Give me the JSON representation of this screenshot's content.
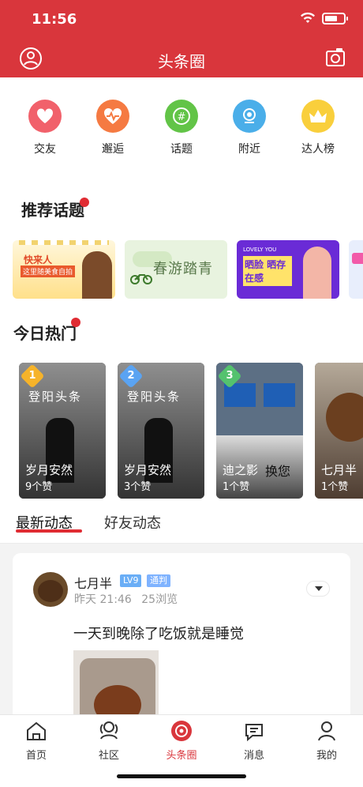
{
  "status_bar": {
    "time": "11:56"
  },
  "header": {
    "title": "头条圈"
  },
  "quick_links": [
    {
      "label": "交友",
      "icon": "heart-icon",
      "color": "#f1616b"
    },
    {
      "label": "邂逅",
      "icon": "pulse-heart-icon",
      "color": "#f57a42"
    },
    {
      "label": "话题",
      "icon": "hash-chat-icon",
      "color": "#62c447"
    },
    {
      "label": "附近",
      "icon": "location-icon",
      "color": "#4aaee9"
    },
    {
      "label": "达人榜",
      "icon": "crown-icon",
      "color": "#f9cf3c"
    }
  ],
  "topics": {
    "title": "推荐话题",
    "banners": [
      {
        "title": "快来人",
        "subtitle": "这里随美食自拍"
      },
      {
        "title": "春游踏青"
      },
      {
        "title": "晒脸 晒存在感",
        "tag": "LOVELY YOU"
      },
      {
        "title": ""
      }
    ]
  },
  "hot": {
    "title": "今日热门",
    "cards": [
      {
        "rank": "1",
        "name": "岁月安然",
        "likes": "9个赞",
        "rank_color": "#f6b32a",
        "sign": "登阳头条"
      },
      {
        "rank": "2",
        "name": "岁月安然",
        "likes": "3个赞",
        "rank_color": "#5aa3f2",
        "sign": "登阳头条"
      },
      {
        "rank": "3",
        "name": "迪之影",
        "likes": "1个赞",
        "rank_color": "#54c26e",
        "sign": "换您"
      },
      {
        "rank": "",
        "name": "七月半",
        "likes": "1个赞",
        "rank_color": "#999999",
        "sign": ""
      }
    ]
  },
  "feed_tabs": {
    "active": "最新动态",
    "inactive": "好友动态"
  },
  "post": {
    "username": "七月半",
    "level": "LV9",
    "role": "通判",
    "time": "昨天 21:46",
    "views": "25浏览",
    "text": "一天到晚除了吃饭就是睡觉"
  },
  "tabbar": {
    "items": [
      {
        "label": "首页",
        "icon": "home-icon"
      },
      {
        "label": "社区",
        "icon": "community-icon"
      },
      {
        "label": "头条圈",
        "icon": "circle-icon"
      },
      {
        "label": "消息",
        "icon": "message-icon"
      },
      {
        "label": "我的",
        "icon": "profile-icon"
      }
    ]
  },
  "colors": {
    "brand": "#d9363c",
    "accent": "#e02c33"
  }
}
